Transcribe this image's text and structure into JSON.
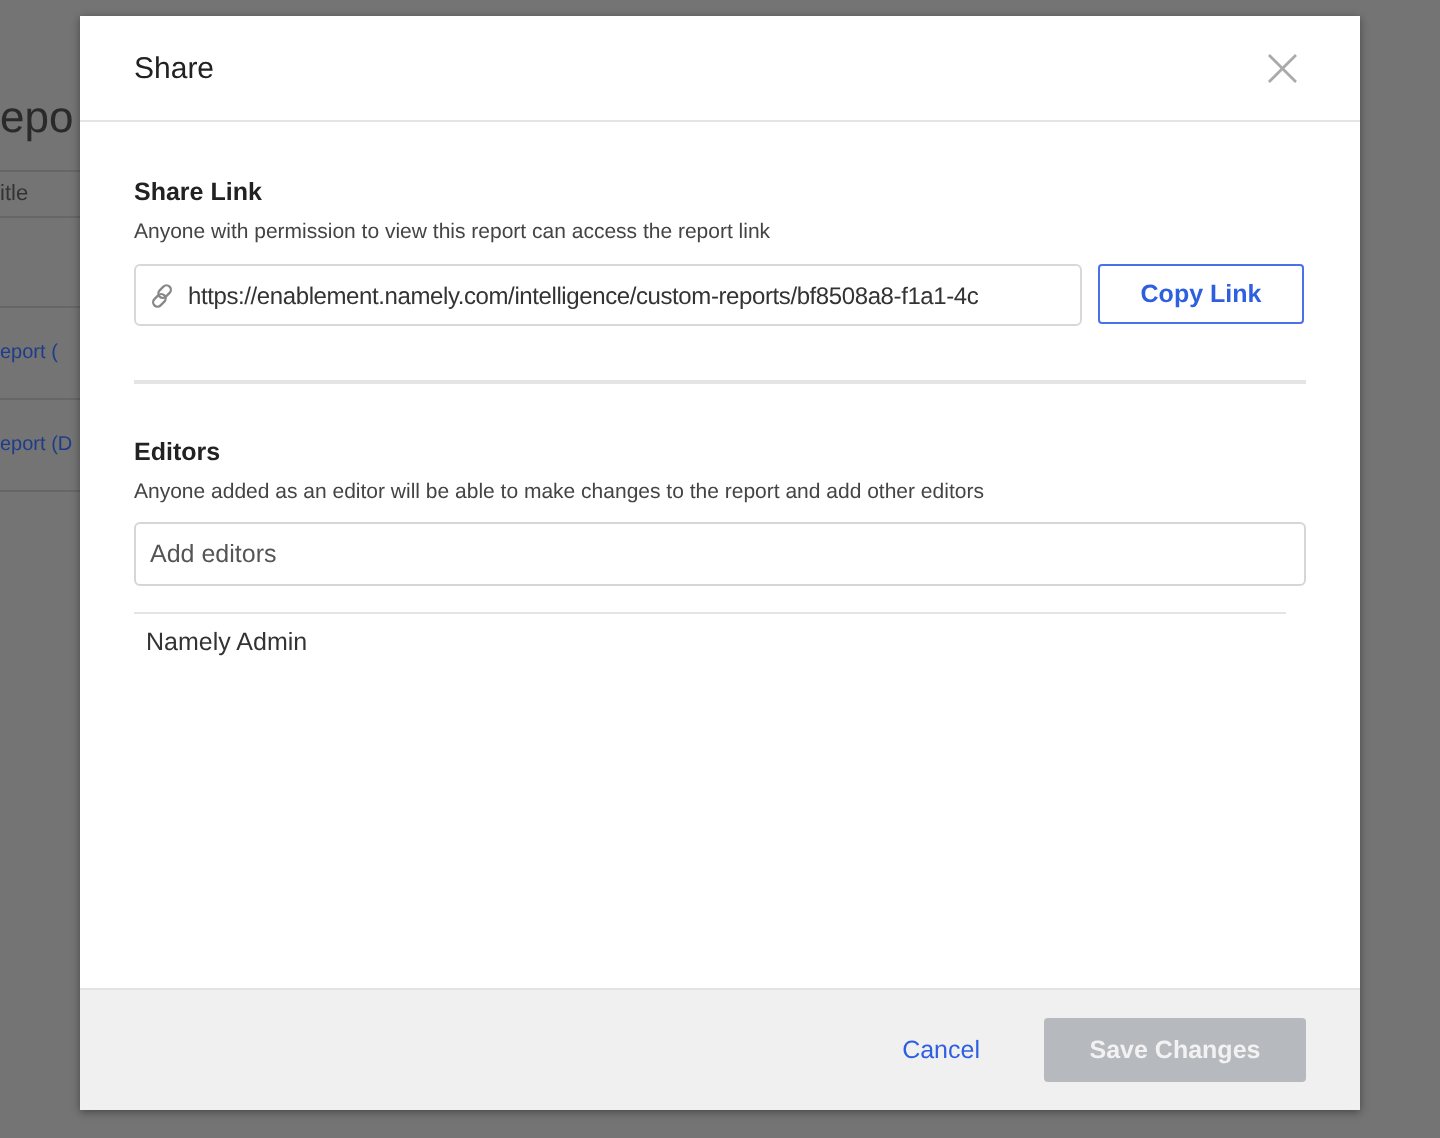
{
  "background_page": {
    "heading": "epo",
    "column_header": "itle",
    "rows": [
      "eport (",
      "eport (D"
    ]
  },
  "dialog": {
    "title": "Share",
    "close_icon": "×",
    "share_link": {
      "heading": "Share Link",
      "description": "Anyone with permission to view this report can access the report link",
      "url": "https://enablement.namely.com/intelligence/custom-reports/bf8508a8-f1a1-4c",
      "copy_button": "Copy Link"
    },
    "editors": {
      "heading": "Editors",
      "description": "Anyone added as an editor will be able to make changes to the report and add other editors",
      "placeholder": "Add editors",
      "list": [
        "Namely Admin"
      ]
    },
    "footer": {
      "cancel": "Cancel",
      "save": {
        "label": "Save Changes",
        "disabled": true
      }
    }
  }
}
